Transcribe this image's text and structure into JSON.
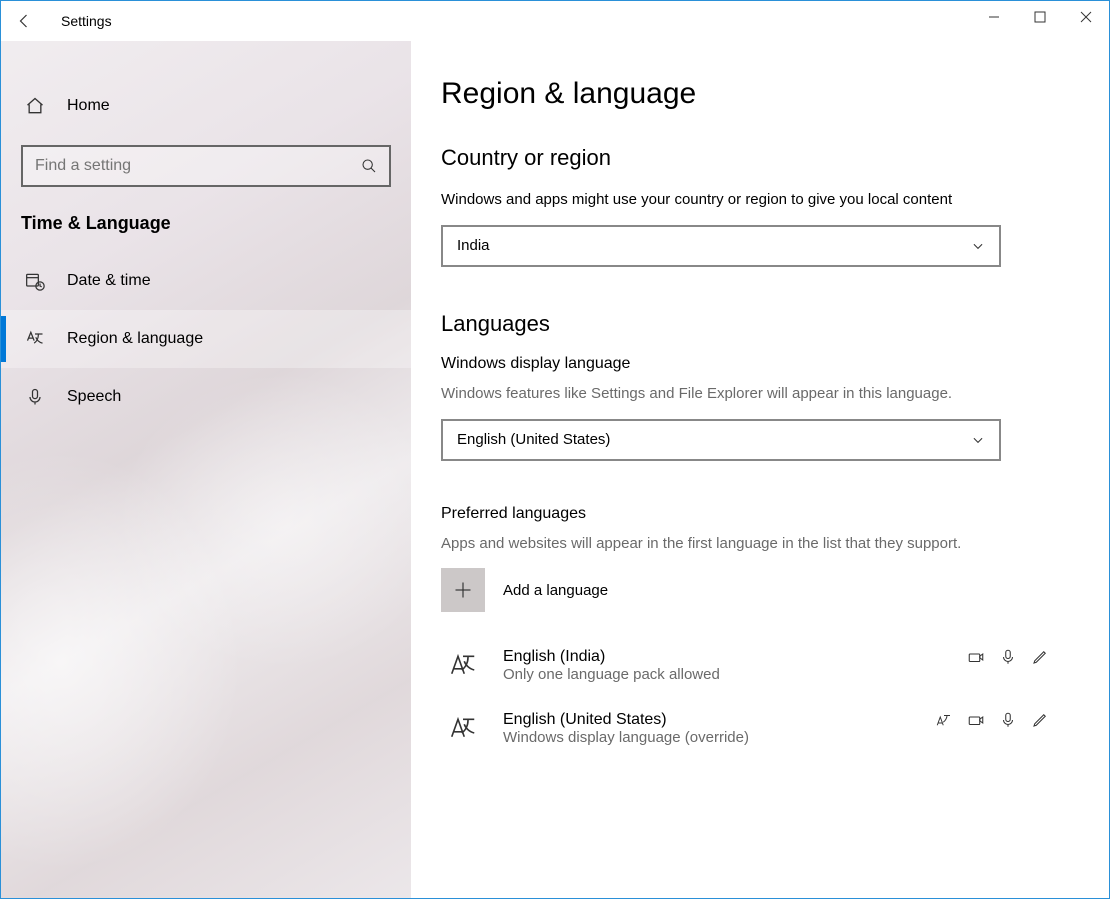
{
  "window": {
    "title": "Settings"
  },
  "sidebar": {
    "home": "Home",
    "search_placeholder": "Find a setting",
    "category": "Time & Language",
    "items": [
      {
        "label": "Date & time"
      },
      {
        "label": "Region & language"
      },
      {
        "label": "Speech"
      }
    ]
  },
  "page": {
    "title": "Region & language",
    "country_section": {
      "heading": "Country or region",
      "desc": "Windows and apps might use your country or region to give you local content",
      "value": "India"
    },
    "languages_section": {
      "heading": "Languages",
      "display": {
        "label": "Windows display language",
        "desc": "Windows features like Settings and File Explorer will appear in this language.",
        "value": "English (United States)"
      },
      "preferred": {
        "label": "Preferred languages",
        "desc": "Apps and websites will appear in the first language in the list that they support.",
        "add": "Add a language",
        "items": [
          {
            "name": "English (India)",
            "sub": "Only one language pack allowed",
            "features": [
              "speech",
              "keyboard",
              "handwriting"
            ]
          },
          {
            "name": "English (United States)",
            "sub": "Windows display language (override)",
            "features": [
              "display",
              "speech",
              "keyboard",
              "handwriting"
            ]
          }
        ]
      }
    }
  }
}
